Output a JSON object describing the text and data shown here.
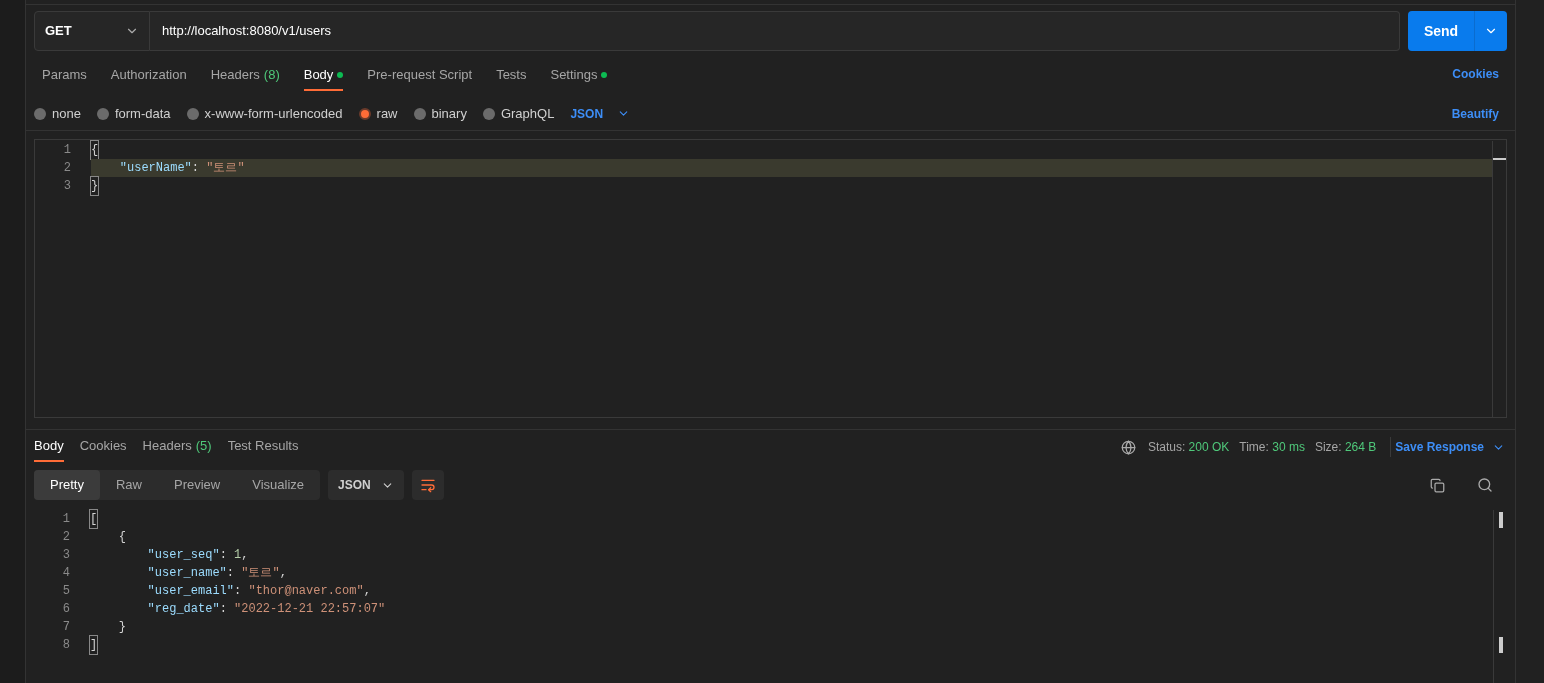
{
  "request": {
    "method": "GET",
    "url": "http://localhost:8080/v1/users",
    "send_label": "Send"
  },
  "request_tabs": [
    {
      "label": "Params",
      "selected": false
    },
    {
      "label": "Authorization",
      "selected": false
    },
    {
      "label": "Headers",
      "count": "(8)",
      "selected": false
    },
    {
      "label": "Body",
      "selected": true,
      "dot": true
    },
    {
      "label": "Pre-request Script",
      "selected": false
    },
    {
      "label": "Tests",
      "selected": false
    },
    {
      "label": "Settings",
      "selected": false,
      "dot": true
    }
  ],
  "cookies_link": "Cookies",
  "body_types": [
    {
      "label": "none",
      "selected": false
    },
    {
      "label": "form-data",
      "selected": false
    },
    {
      "label": "x-www-form-urlencoded",
      "selected": false
    },
    {
      "label": "raw",
      "selected": true
    },
    {
      "label": "binary",
      "selected": false
    },
    {
      "label": "GraphQL",
      "selected": false
    }
  ],
  "format_select": "JSON",
  "beautify_link": "Beautify",
  "request_body": [
    {
      "number": "1",
      "highlighted": false,
      "tokens": [
        {
          "kind": "bracket",
          "text": "{"
        }
      ]
    },
    {
      "number": "2",
      "highlighted": true,
      "tokens": [
        {
          "kind": "key",
          "text": "    \"userName\""
        },
        {
          "kind": "punct",
          "text": ": "
        },
        {
          "kind": "string",
          "text": "\"토르\""
        }
      ]
    },
    {
      "number": "3",
      "highlighted": false,
      "tokens": [
        {
          "kind": "bracket",
          "text": "}"
        }
      ]
    }
  ],
  "response_tabs": [
    {
      "label": "Body",
      "selected": true
    },
    {
      "label": "Cookies",
      "selected": false
    },
    {
      "label": "Headers",
      "count": "(5)",
      "selected": false
    },
    {
      "label": "Test Results",
      "selected": false
    }
  ],
  "response_meta": [
    {
      "label": "Status:",
      "value": "200 OK"
    },
    {
      "label": "Time:",
      "value": "30 ms"
    },
    {
      "label": "Size:",
      "value": "264 B"
    }
  ],
  "save_response": "Save Response",
  "view_modes": [
    {
      "label": "Pretty",
      "selected": true
    },
    {
      "label": "Raw",
      "selected": false
    },
    {
      "label": "Preview",
      "selected": false
    },
    {
      "label": "Visualize",
      "selected": false
    }
  ],
  "response_format": "JSON",
  "response_body": [
    {
      "number": "1",
      "tokens": [
        {
          "kind": "bracket",
          "text": "["
        }
      ]
    },
    {
      "number": "2",
      "tokens": [
        {
          "kind": "punct",
          "text": "    {"
        }
      ]
    },
    {
      "number": "3",
      "tokens": [
        {
          "kind": "key",
          "text": "        \"user_seq\""
        },
        {
          "kind": "punct",
          "text": ": "
        },
        {
          "kind": "number",
          "text": "1"
        },
        {
          "kind": "punct",
          "text": ","
        }
      ]
    },
    {
      "number": "4",
      "tokens": [
        {
          "kind": "key",
          "text": "        \"user_name\""
        },
        {
          "kind": "punct",
          "text": ": "
        },
        {
          "kind": "string",
          "text": "\"토르\""
        },
        {
          "kind": "punct",
          "text": ","
        }
      ]
    },
    {
      "number": "5",
      "tokens": [
        {
          "kind": "key",
          "text": "        \"user_email\""
        },
        {
          "kind": "punct",
          "text": ": "
        },
        {
          "kind": "string",
          "text": "\"thor@naver.com\""
        },
        {
          "kind": "punct",
          "text": ","
        }
      ]
    },
    {
      "number": "6",
      "tokens": [
        {
          "kind": "key",
          "text": "        \"reg_date\""
        },
        {
          "kind": "punct",
          "text": ": "
        },
        {
          "kind": "string",
          "text": "\"2022-12-21 22:57:07\""
        }
      ]
    },
    {
      "number": "7",
      "tokens": [
        {
          "kind": "punct",
          "text": "    }"
        }
      ]
    },
    {
      "number": "8",
      "tokens": [
        {
          "kind": "bracket",
          "text": "]"
        }
      ]
    }
  ]
}
